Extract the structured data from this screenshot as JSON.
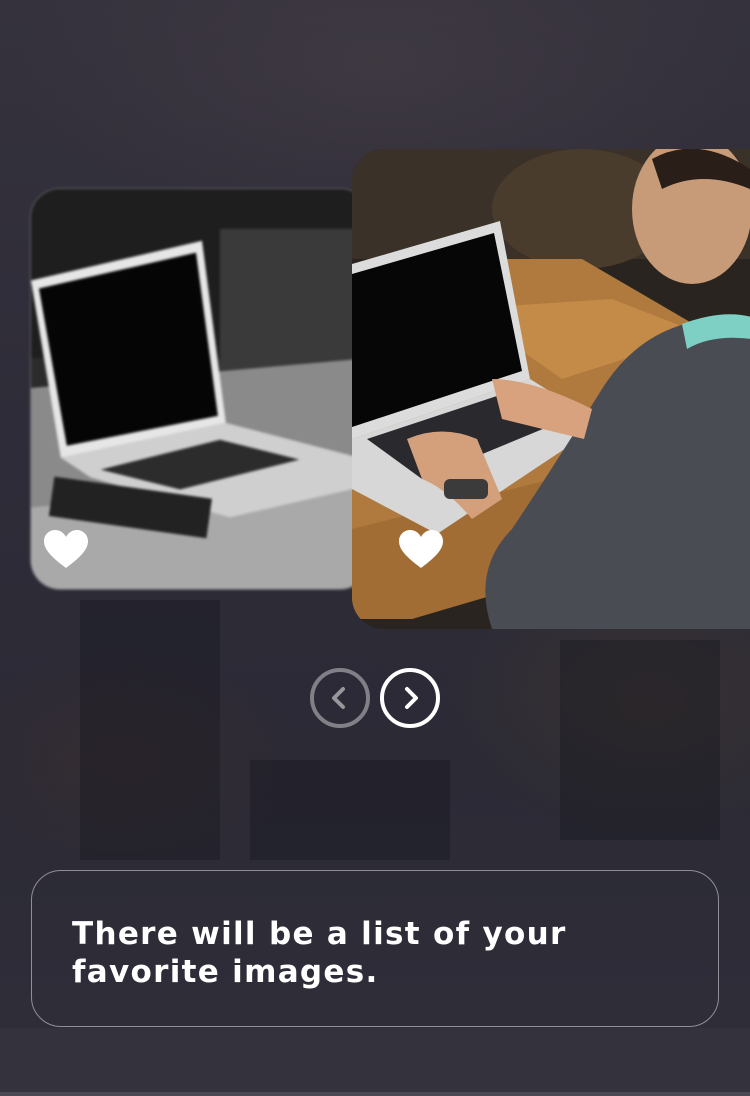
{
  "carousel": {
    "cards": [
      {
        "name": "laptop-on-table-photo",
        "favorite_icon": "heart-icon",
        "state": "inactive"
      },
      {
        "name": "man-typing-on-laptop-photo",
        "favorite_icon": "heart-icon",
        "state": "active"
      }
    ],
    "prev_icon": "chevron-left-icon",
    "next_icon": "chevron-right-icon"
  },
  "info": {
    "text": "There will be a list of your favorite images."
  },
  "colors": {
    "background": "#2f2d3a",
    "text": "#ffffff",
    "nav_inactive": "#96969b",
    "nav_active": "#ffffff"
  }
}
